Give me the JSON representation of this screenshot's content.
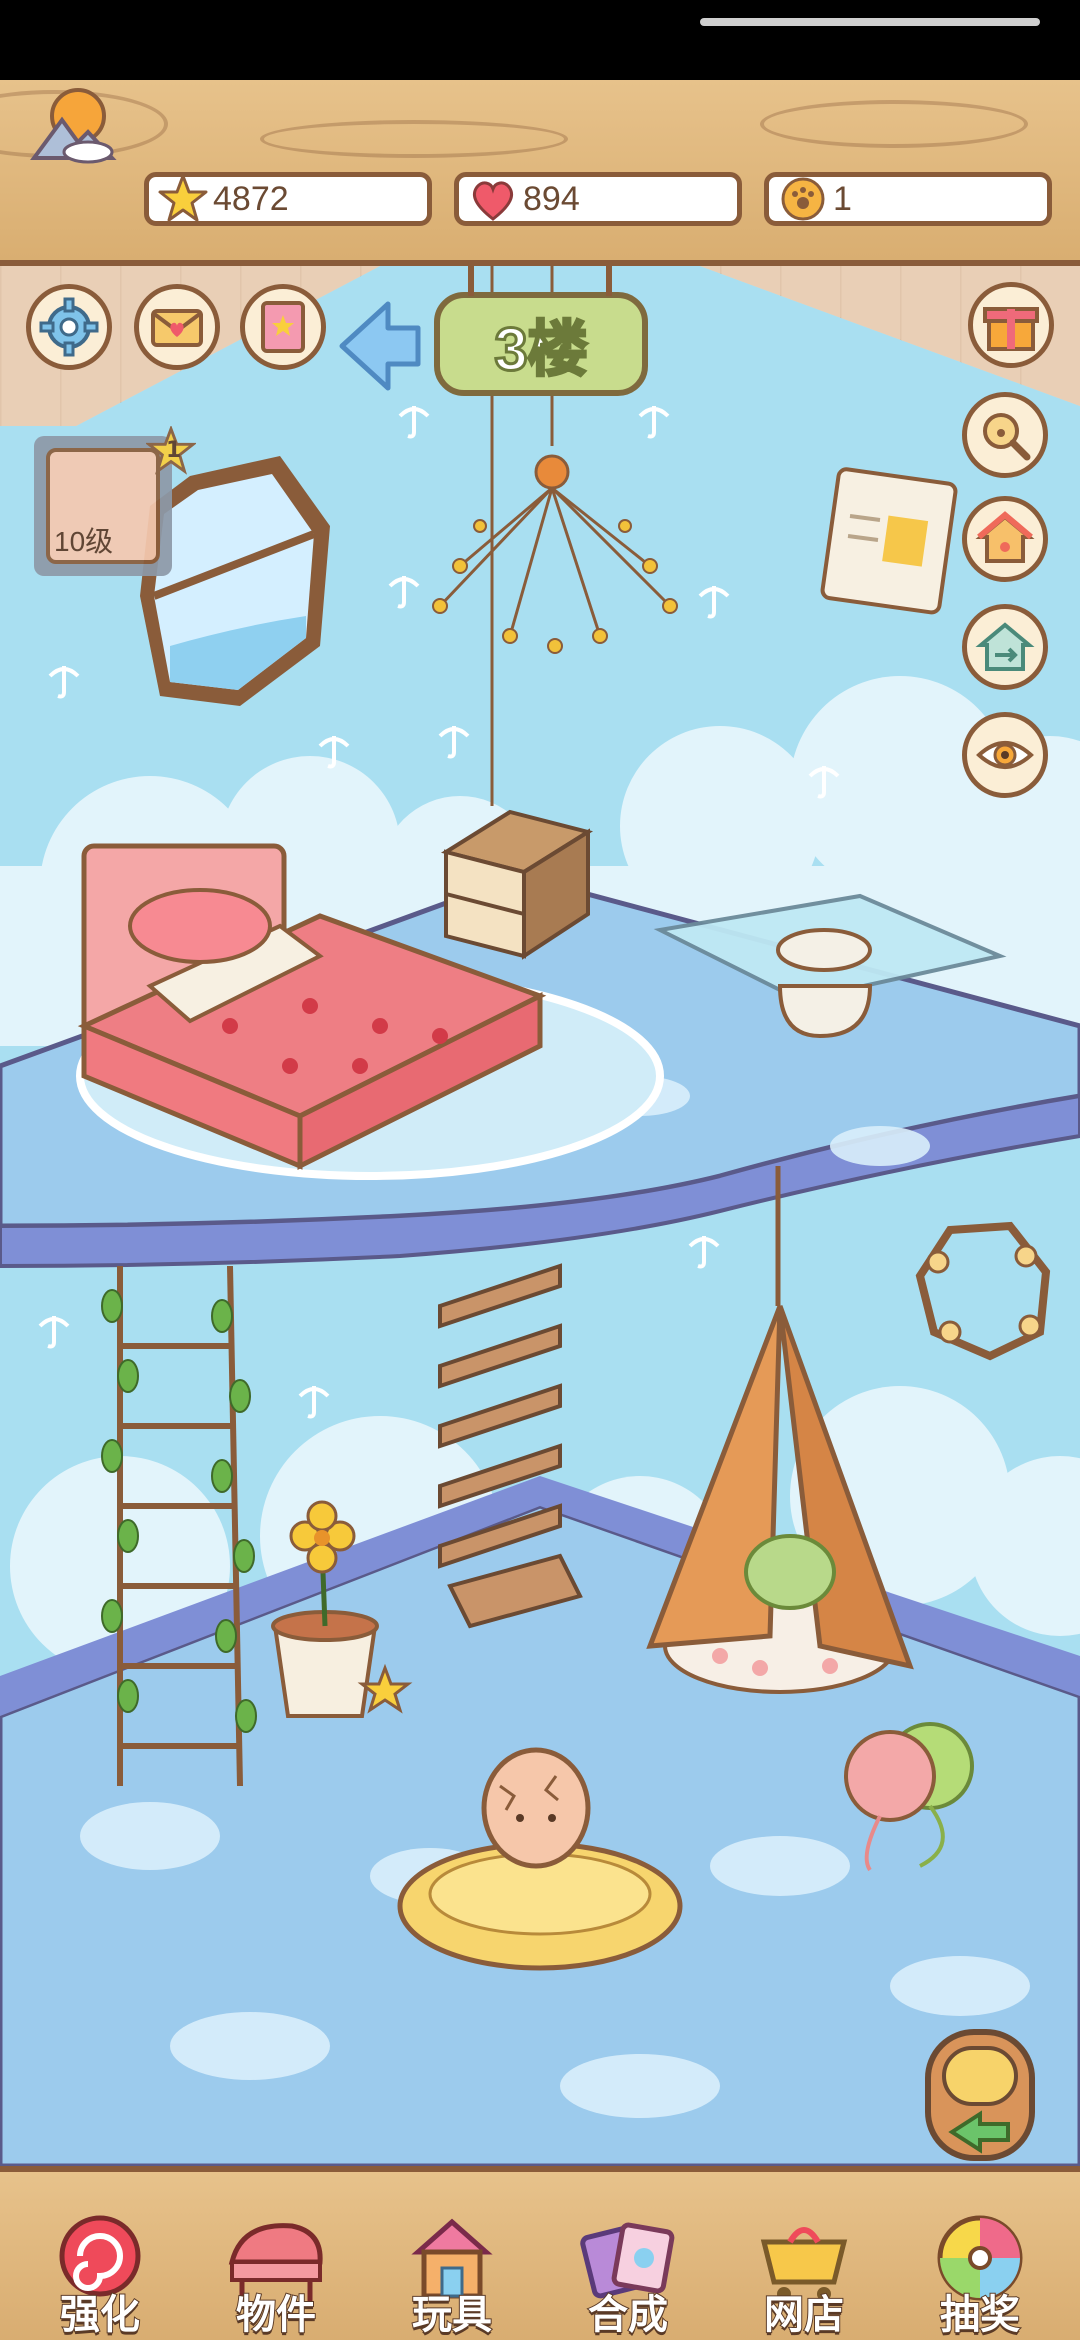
{
  "header": {
    "currencies": [
      {
        "name": "stars",
        "icon": "star-icon",
        "value": "4872"
      },
      {
        "name": "hearts",
        "icon": "heart-icon",
        "value": "894"
      },
      {
        "name": "paw-coins",
        "icon": "paw-coin-icon",
        "value": "1"
      }
    ]
  },
  "room": {
    "floor_label": "3楼",
    "level_label": "10级",
    "level_badge_count": "1"
  },
  "toolbar": {
    "items": [
      {
        "label": "强化",
        "icon": "lollipop-icon"
      },
      {
        "label": "物件",
        "icon": "piano-icon"
      },
      {
        "label": "玩具",
        "icon": "toy-house-icon"
      },
      {
        "label": "合成",
        "icon": "cards-icon"
      },
      {
        "label": "网店",
        "icon": "shop-cart-icon"
      },
      {
        "label": "抽奖",
        "icon": "prize-wheel-icon"
      }
    ]
  },
  "colors": {
    "wood": "#d9ae71",
    "wood_dark": "#8a5c3a",
    "wall": "#a9dff1",
    "floor": "#9ccbed",
    "floor_edge": "#7f8fd6",
    "sign_green": "#c8dc8d"
  }
}
